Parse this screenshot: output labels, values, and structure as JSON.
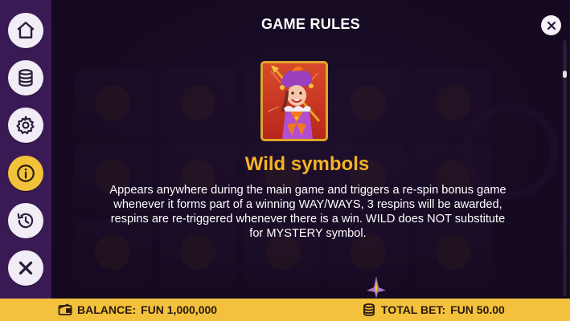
{
  "header": {
    "title": "GAME RULES"
  },
  "sidebar": {
    "items": [
      {
        "icon": "home-icon"
      },
      {
        "icon": "coins-stack-icon"
      },
      {
        "icon": "gear-icon"
      },
      {
        "icon": "info-icon",
        "active": true
      },
      {
        "icon": "history-icon"
      },
      {
        "icon": "close-icon"
      }
    ]
  },
  "content": {
    "symbol_icon": "jester-wild-symbol",
    "section_title": "Wild symbols",
    "description": "Appears anywhere during the main game and triggers a re-spin bonus game whenever it forms part of a winning WAY/WAYS, 3 respins will be awarded, respins are re-triggered whenever there is a win. WILD does NOT substitute for MYSTERY symbol."
  },
  "bottom_bar": {
    "balance_label": "BALANCE:",
    "balance_value": "FUN 1,000,000",
    "bet_label": "TOTAL BET:",
    "bet_value": "FUN 50.00"
  },
  "colors": {
    "accent": "#f5b324",
    "bar": "#f3c13c",
    "sidebar": "#3a1a55",
    "active_button": "#f2c23b"
  }
}
